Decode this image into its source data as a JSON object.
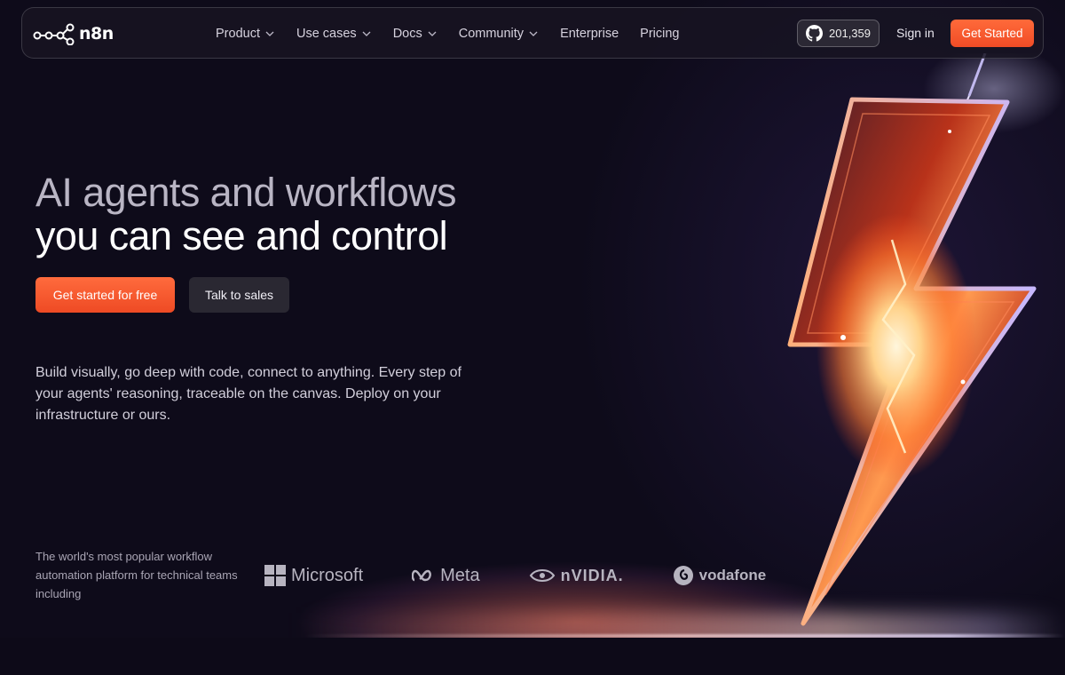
{
  "nav": {
    "logo_text": "n8n",
    "menu": [
      {
        "label": "Product",
        "has_dropdown": true
      },
      {
        "label": "Use cases",
        "has_dropdown": true
      },
      {
        "label": "Docs",
        "has_dropdown": true
      },
      {
        "label": "Community",
        "has_dropdown": true
      },
      {
        "label": "Enterprise",
        "has_dropdown": false
      },
      {
        "label": "Pricing",
        "has_dropdown": false
      }
    ],
    "github_stars": "201,359",
    "github_icon": "github-icon",
    "sign_in": "Sign in",
    "get_started": "Get Started"
  },
  "hero": {
    "headline_line1": "AI agents and workflows",
    "headline_line2": "you can see and control",
    "primary_cta": "Get started for free",
    "secondary_cta": "Talk to sales",
    "description": "Build visually, go deep with code, connect to anything. Every step of your agents' reasoning, traceable on the canvas. Deploy on your infrastructure or ours."
  },
  "trust": {
    "text": "The world's most popular workflow automation platform for technical teams including",
    "logos": [
      "Microsoft",
      "Meta",
      "nVIDIA.",
      "vodafone"
    ]
  },
  "colors": {
    "accent": "#ff6533",
    "background": "#0e0b1a",
    "headline_muted": "#b9b5c4"
  }
}
